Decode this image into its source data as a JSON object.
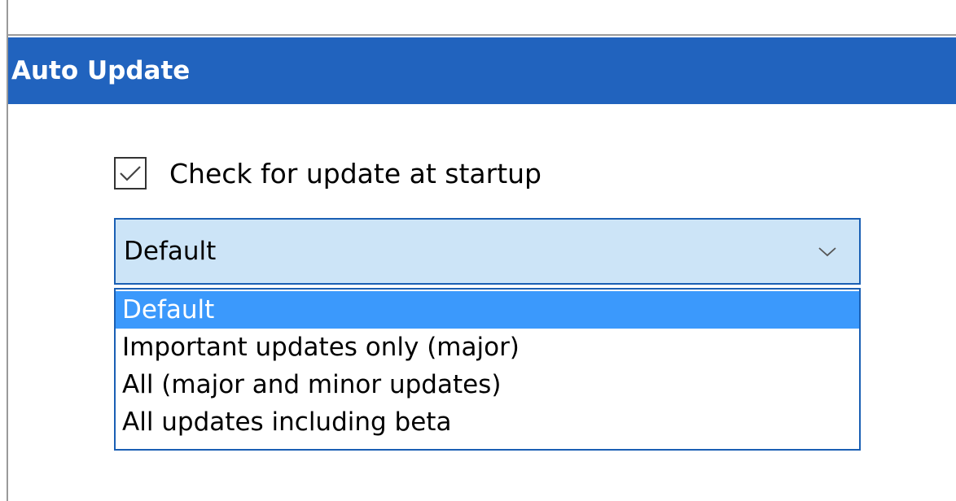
{
  "section": {
    "title": "Auto Update"
  },
  "check_update": {
    "label": "Check for update at startup",
    "checked": true
  },
  "update_mode": {
    "selected": "Default",
    "options": [
      "Default",
      "Important updates only (major)",
      "All (major and minor updates)",
      "All updates including beta"
    ],
    "highlighted_index": 0
  },
  "colors": {
    "header_bg": "#2163be",
    "selection_bg": "#3b99fc",
    "combo_bg": "#cce4f7",
    "combo_border": "#1a5fb4"
  },
  "icons": {
    "checkbox": "checkmark-icon",
    "combo": "chevron-down-icon"
  }
}
